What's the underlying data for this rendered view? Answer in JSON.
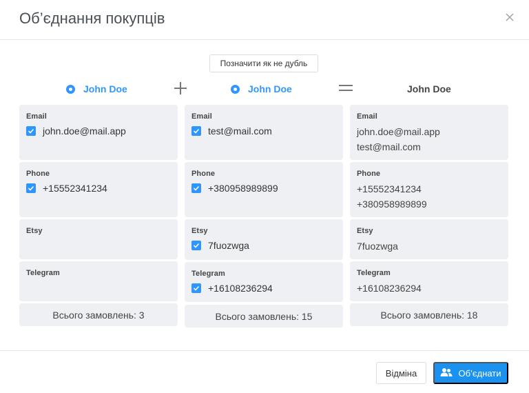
{
  "dialog": {
    "title": "Об’єднання покупців"
  },
  "actions": {
    "not_duplicate": "Позначити як не дубль",
    "cancel": "Відміна",
    "merge": "Об’єднати"
  },
  "customers": [
    {
      "name": "John Doe",
      "email_label": "Email",
      "emails": [
        "john.doe@mail.app"
      ],
      "phone_label": "Phone",
      "phones": [
        "+15552341234"
      ],
      "etsy_label": "Etsy",
      "etsy": [],
      "telegram_label": "Telegram",
      "telegram": [],
      "total": "Всього замовлень: 3"
    },
    {
      "name": "John Doe",
      "email_label": "Email",
      "emails": [
        "test@mail.com"
      ],
      "phone_label": "Phone",
      "phones": [
        "+380958989899"
      ],
      "etsy_label": "Etsy",
      "etsy": [
        "7fuozwga"
      ],
      "telegram_label": "Telegram",
      "telegram": [
        "+16108236294"
      ],
      "total": "Всього замовлень: 15"
    }
  ],
  "result": {
    "name": "John Doe",
    "email_label": "Email",
    "emails": [
      "john.doe@mail.app",
      "test@mail.com"
    ],
    "phone_label": "Phone",
    "phones": [
      "+15552341234",
      "+380958989899"
    ],
    "etsy_label": "Etsy",
    "etsy": [
      "7fuozwga"
    ],
    "telegram_label": "Telegram",
    "telegram": [
      "+16108236294"
    ],
    "total": "Всього замовлень: 18"
  },
  "icons": {
    "close": "close-icon",
    "plus": "plus-icon",
    "equals": "equals-icon",
    "merge": "users-icon"
  },
  "colors": {
    "accent": "#2f96ff",
    "card_bg": "#eef0f3",
    "merge_button": "#1b92f0"
  }
}
